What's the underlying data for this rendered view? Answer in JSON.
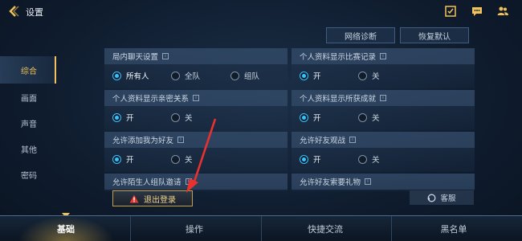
{
  "header": {
    "title": "设置"
  },
  "top_icons": [
    "tasks-icon",
    "chat-icon",
    "friends-icon"
  ],
  "utility_buttons": {
    "network": "网络诊断",
    "restore": "恢复默认"
  },
  "sidebar": {
    "items": [
      {
        "label": "综合",
        "active": true
      },
      {
        "label": "画面",
        "active": false
      },
      {
        "label": "声音",
        "active": false
      },
      {
        "label": "其他",
        "active": false
      },
      {
        "label": "密码",
        "active": false
      }
    ]
  },
  "settings": {
    "room_chat": {
      "title": "局内聊天设置",
      "options": [
        "所有人",
        "全队",
        "组队"
      ],
      "selected": "所有人"
    },
    "show_match_record": {
      "title": "个人资料显示比赛记录",
      "options": [
        "开",
        "关"
      ],
      "selected": "开"
    },
    "show_relations": {
      "title": "个人资料显示亲密关系",
      "options": [
        "开",
        "关"
      ],
      "selected": "开"
    },
    "show_achievements": {
      "title": "个人资料显示所获成就",
      "options": [
        "开",
        "关"
      ],
      "selected": "开"
    },
    "allow_add_friend": {
      "title": "允许添加我为好友",
      "options": [
        "开",
        "关"
      ],
      "selected": "开"
    },
    "allow_spectate": {
      "title": "允许好友观战",
      "options": [
        "开",
        "关"
      ],
      "selected": "开"
    },
    "stranger_invite": {
      "title": "允许陌生人组队邀请"
    },
    "gift_request": {
      "title": "允许好友索要礼物"
    }
  },
  "actions": {
    "logout": "退出登录",
    "customer_service": "客服"
  },
  "bottom_tabs": [
    {
      "label": "基础",
      "active": true
    },
    {
      "label": "操作",
      "active": false
    },
    {
      "label": "快捷交流",
      "active": false
    },
    {
      "label": "黑名单",
      "active": false
    }
  ],
  "colors": {
    "accent": "#f2c25a",
    "radio_on": "#37c3ff",
    "warning": "#e23b2e"
  }
}
